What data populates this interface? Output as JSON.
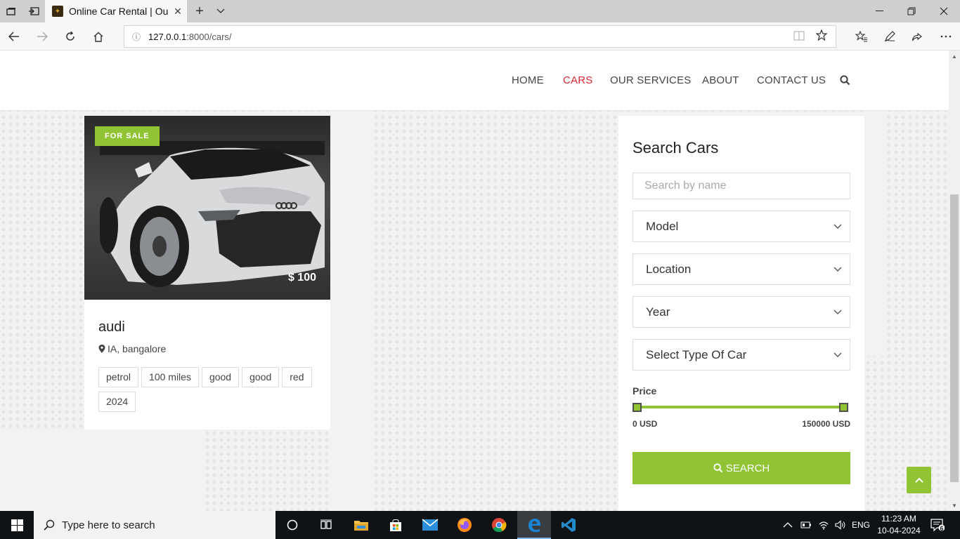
{
  "browser": {
    "tab_title": "Online Car Rental | Our",
    "url_host": "127.0.0.1",
    "url_path": ":8000/cars/"
  },
  "nav": {
    "items": [
      {
        "label": "HOME",
        "active": false
      },
      {
        "label": "CARS",
        "active": true
      },
      {
        "label": "OUR SERVICES",
        "active": false
      },
      {
        "label": "ABOUT",
        "active": false
      },
      {
        "label": "CONTACT US",
        "active": false
      }
    ]
  },
  "car": {
    "badge": "FOR SALE",
    "price": "$ 100",
    "name": "audi",
    "location": "IA, bangalore",
    "tags": [
      "petrol",
      "100 miles",
      "good",
      "good",
      "red",
      "2024"
    ]
  },
  "search": {
    "title": "Search Cars",
    "name_placeholder": "Search by name",
    "model": "Model",
    "location": "Location",
    "year": "Year",
    "type": "Select Type Of Car",
    "price_label": "Price",
    "price_min": "0 USD",
    "price_max": "150000 USD",
    "button": "SEARCH"
  },
  "taskbar": {
    "search_placeholder": "Type here to search",
    "lang": "ENG",
    "time": "11:23 AM",
    "date": "10-04-2024",
    "notifications": "6"
  },
  "colors": {
    "accent": "#91c435",
    "active_nav": "#e0262e"
  }
}
